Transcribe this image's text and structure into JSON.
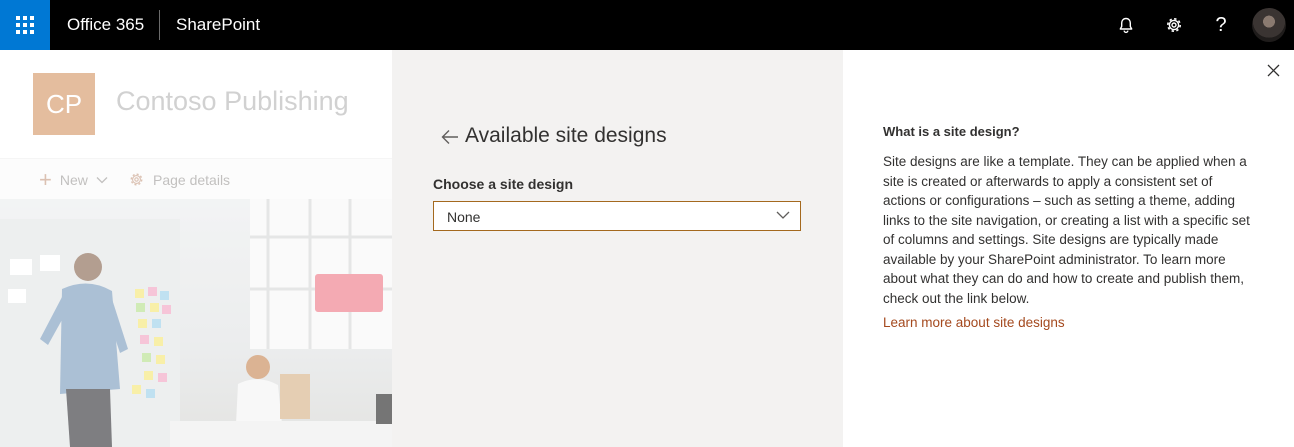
{
  "suite_bar": {
    "brand": "Office 365",
    "app_name": "SharePoint",
    "icons": [
      "waffle-icon",
      "bell-icon",
      "gear-icon",
      "help-icon",
      "avatar"
    ],
    "accent_color": "#0078d4"
  },
  "site": {
    "logo_initials": "CP",
    "logo_color": "#d69a6b",
    "title": "Contoso Publishing",
    "commands": {
      "new_label": "New",
      "page_details_label": "Page details"
    }
  },
  "panel": {
    "title": "Available site designs",
    "field_label": "Choose a site design",
    "select_value": "None",
    "info_heading": "What is a site design?",
    "info_text": "Site designs are like a template. They can be applied when a site is created or afterwards to apply a consistent set of actions or configurations – such as setting a theme, adding links to the site navigation, or creating a list with a specific set of columns and settings. Site designs are typically made available by your SharePoint administrator. To learn more about what they can do and how to create and publish them, check out the link below.",
    "link_text": "Learn more about site designs",
    "link_color": "#a4491e"
  }
}
